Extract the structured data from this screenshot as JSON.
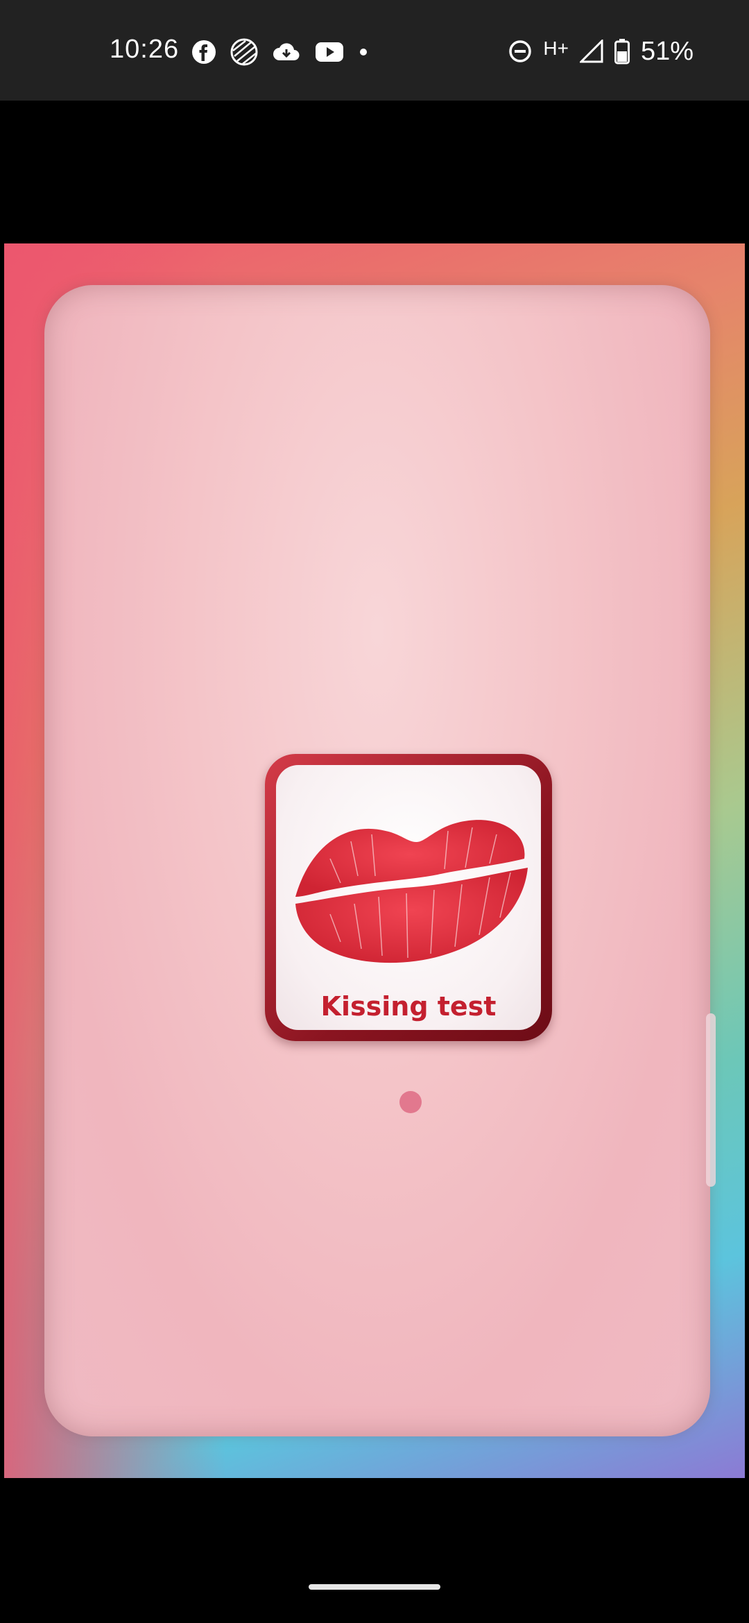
{
  "status_bar": {
    "time": "10:26",
    "network": "H+",
    "battery": "51%",
    "left_icons": [
      "facebook-icon",
      "globe-icon",
      "cloud-icon",
      "youtube-icon",
      "dot-icon"
    ],
    "right_icons": [
      "do-not-disturb-icon",
      "network-type",
      "signal-icon",
      "battery-icon"
    ]
  },
  "video": {
    "app_icon": {
      "label": "Kissing test",
      "icon": "lips-icon"
    },
    "page_indicator": {
      "count": 1,
      "active": 1
    }
  },
  "colors": {
    "status_bar_bg": "#222222",
    "lip_red": "#e0323f",
    "label_red": "#c4202f",
    "dot_pink": "#e2788e"
  }
}
